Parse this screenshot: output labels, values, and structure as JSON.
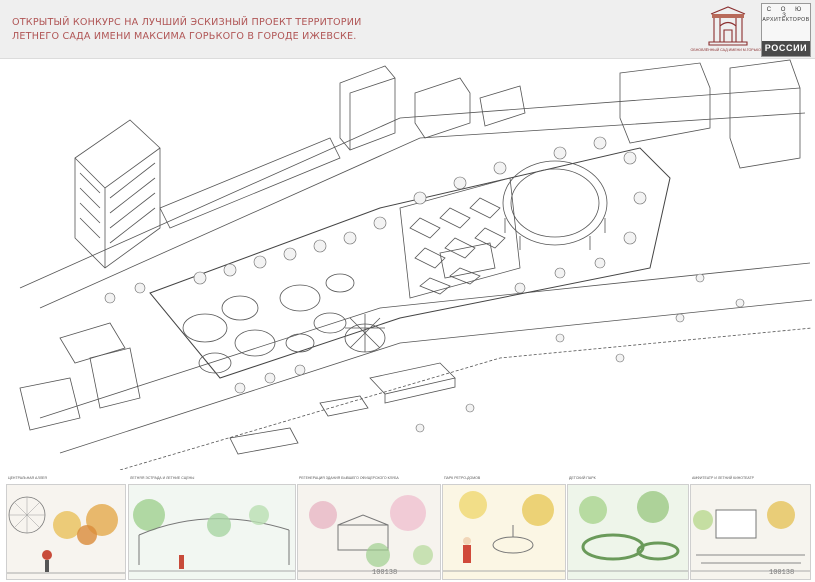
{
  "header": {
    "title_line_1": "ОТКРЫТЫЙ КОНКУРС НА ЛУЧШИЙ ЭСКИЗНЫЙ ПРОЕКТ ТЕРРИТОРИИ",
    "title_line_2": "ЛЕТНЕГО САДА ИМЕНИ МАКСИМА ГОРЬКОГО В ГОРОДЕ ИЖЕВСКЕ.",
    "org_caption": "ОБНОВЛЁННЫЙ САД ИМЕНИ М.ГОРЬКОГО",
    "union_logo": {
      "top": "С О Ю З",
      "middle": "АРХИТЕКТОРОВ",
      "bottom": "РОССИИ"
    }
  },
  "panels": [
    {
      "caption": "центральная аллея",
      "number": ""
    },
    {
      "caption": "летняя эстрада и летние сцены",
      "number": ""
    },
    {
      "caption": "регенерация здания бывшего офицерского клуба",
      "number": "100138"
    },
    {
      "caption": "парк ретро-домов",
      "number": ""
    },
    {
      "caption": "детский парк",
      "number": ""
    },
    {
      "caption": "амфитеатр и летний кинотеатр",
      "number": "100138"
    }
  ],
  "colors": {
    "title": "#b05555",
    "logo_red": "#8a2e2e",
    "ink": "#555555",
    "tree_fill": "#f3f3f3"
  }
}
